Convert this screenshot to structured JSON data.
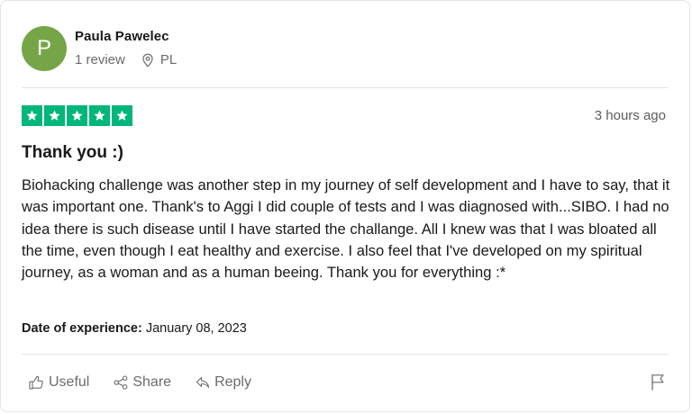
{
  "reviewer": {
    "avatar_letter": "P",
    "avatar_color": "#76a548",
    "name": "Paula Pawelec",
    "review_count": "1 review",
    "location_icon": "location-pin-icon",
    "country": "PL"
  },
  "review": {
    "rating": 5,
    "max_rating": 5,
    "star_color": "#00b67a",
    "posted_ago": "3 hours ago",
    "title": "Thank you :)",
    "body": "Biohacking challenge was another step in my journey of self development and I have to say, that it was important one. Thank's to Aggi I did couple of tests and I was diagnosed with...SIBO. I had no idea there is such disease until I have started the challange. All I knew was that I was bloated all the time, even though I eat healthy and exercise. I also feel that I've developed on my spiritual journey, as a woman and as a human beeing. Thank you for everything :*",
    "experience_label": "Date of experience:",
    "experience_date": "January 08, 2023"
  },
  "actions": {
    "useful_label": "Useful",
    "useful_icon": "thumbs-up-icon",
    "share_label": "Share",
    "share_icon": "share-icon",
    "reply_label": "Reply",
    "reply_icon": "reply-icon",
    "report_icon": "flag-icon"
  }
}
